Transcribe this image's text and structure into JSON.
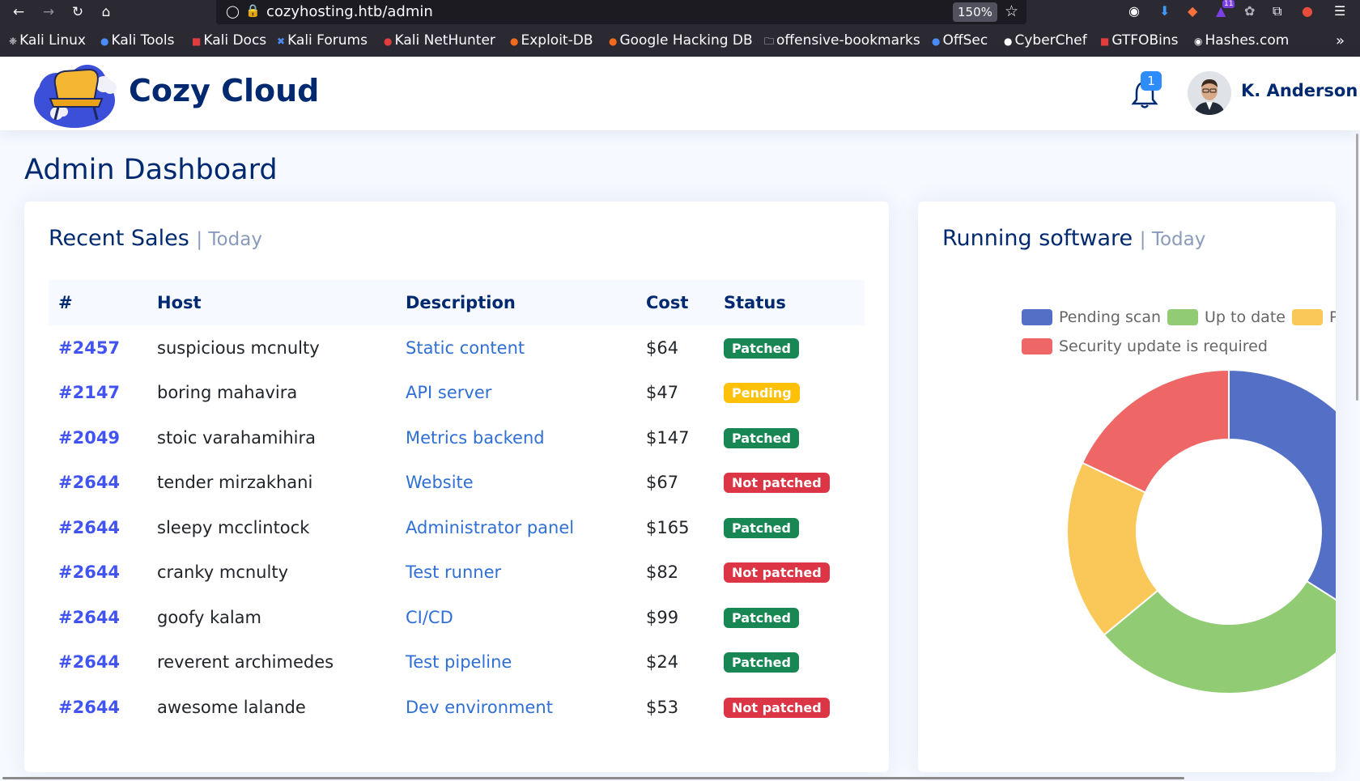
{
  "browser": {
    "url": "cozyhosting.htb/admin",
    "zoom": "150%",
    "extension_badge": "11",
    "bookmarks": [
      "Kali Linux",
      "Kali Tools",
      "Kali Docs",
      "Kali Forums",
      "Kali NetHunter",
      "Exploit-DB",
      "Google Hacking DB",
      "offensive-bookmarks",
      "OffSec",
      "CyberChef",
      "GTFOBins",
      "Hashes.com"
    ]
  },
  "header": {
    "brand": "Cozy Cloud",
    "notification_count": "1",
    "username": "K. Anderson"
  },
  "page": {
    "title": "Admin Dashboard"
  },
  "sales": {
    "title": "Recent Sales",
    "subtitle": "| Today",
    "columns": [
      "#",
      "Host",
      "Description",
      "Cost",
      "Status"
    ],
    "rows": [
      {
        "id": "#2457",
        "host": "suspicious mcnulty",
        "description": "Static content",
        "cost": "$64",
        "status": "Patched",
        "status_type": "success"
      },
      {
        "id": "#2147",
        "host": "boring mahavira",
        "description": "API server",
        "cost": "$47",
        "status": "Pending",
        "status_type": "warning"
      },
      {
        "id": "#2049",
        "host": "stoic varahamihira",
        "description": "Metrics backend",
        "cost": "$147",
        "status": "Patched",
        "status_type": "success"
      },
      {
        "id": "#2644",
        "host": "tender mirzakhani",
        "description": "Website",
        "cost": "$67",
        "status": "Not patched",
        "status_type": "danger"
      },
      {
        "id": "#2644",
        "host": "sleepy mcclintock",
        "description": "Administrator panel",
        "cost": "$165",
        "status": "Patched",
        "status_type": "success"
      },
      {
        "id": "#2644",
        "host": "cranky mcnulty",
        "description": "Test runner",
        "cost": "$82",
        "status": "Not patched",
        "status_type": "danger"
      },
      {
        "id": "#2644",
        "host": "goofy kalam",
        "description": "CI/CD",
        "cost": "$99",
        "status": "Patched",
        "status_type": "success"
      },
      {
        "id": "#2644",
        "host": "reverent archimedes",
        "description": "Test pipeline",
        "cost": "$24",
        "status": "Patched",
        "status_type": "success"
      },
      {
        "id": "#2644",
        "host": "awesome lalande",
        "description": "Dev environment",
        "cost": "$53",
        "status": "Not patched",
        "status_type": "danger"
      }
    ]
  },
  "software": {
    "title": "Running software",
    "subtitle": "| Today",
    "legend": [
      {
        "label": "Pending scan",
        "color": "#5470c6"
      },
      {
        "label": "Up to date",
        "color": "#91cc75"
      },
      {
        "label": "Pen",
        "color": "#fac858"
      },
      {
        "label": "Security update is required",
        "color": "#ee6666"
      }
    ]
  },
  "chart_data": {
    "type": "pie",
    "categories": [
      "Pending scan",
      "Up to date",
      "Pending",
      "Security update is required"
    ],
    "values": [
      34,
      30,
      18,
      18
    ],
    "colors": [
      "#5470c6",
      "#91cc75",
      "#fac858",
      "#ee6666"
    ],
    "legend_position": "top"
  }
}
